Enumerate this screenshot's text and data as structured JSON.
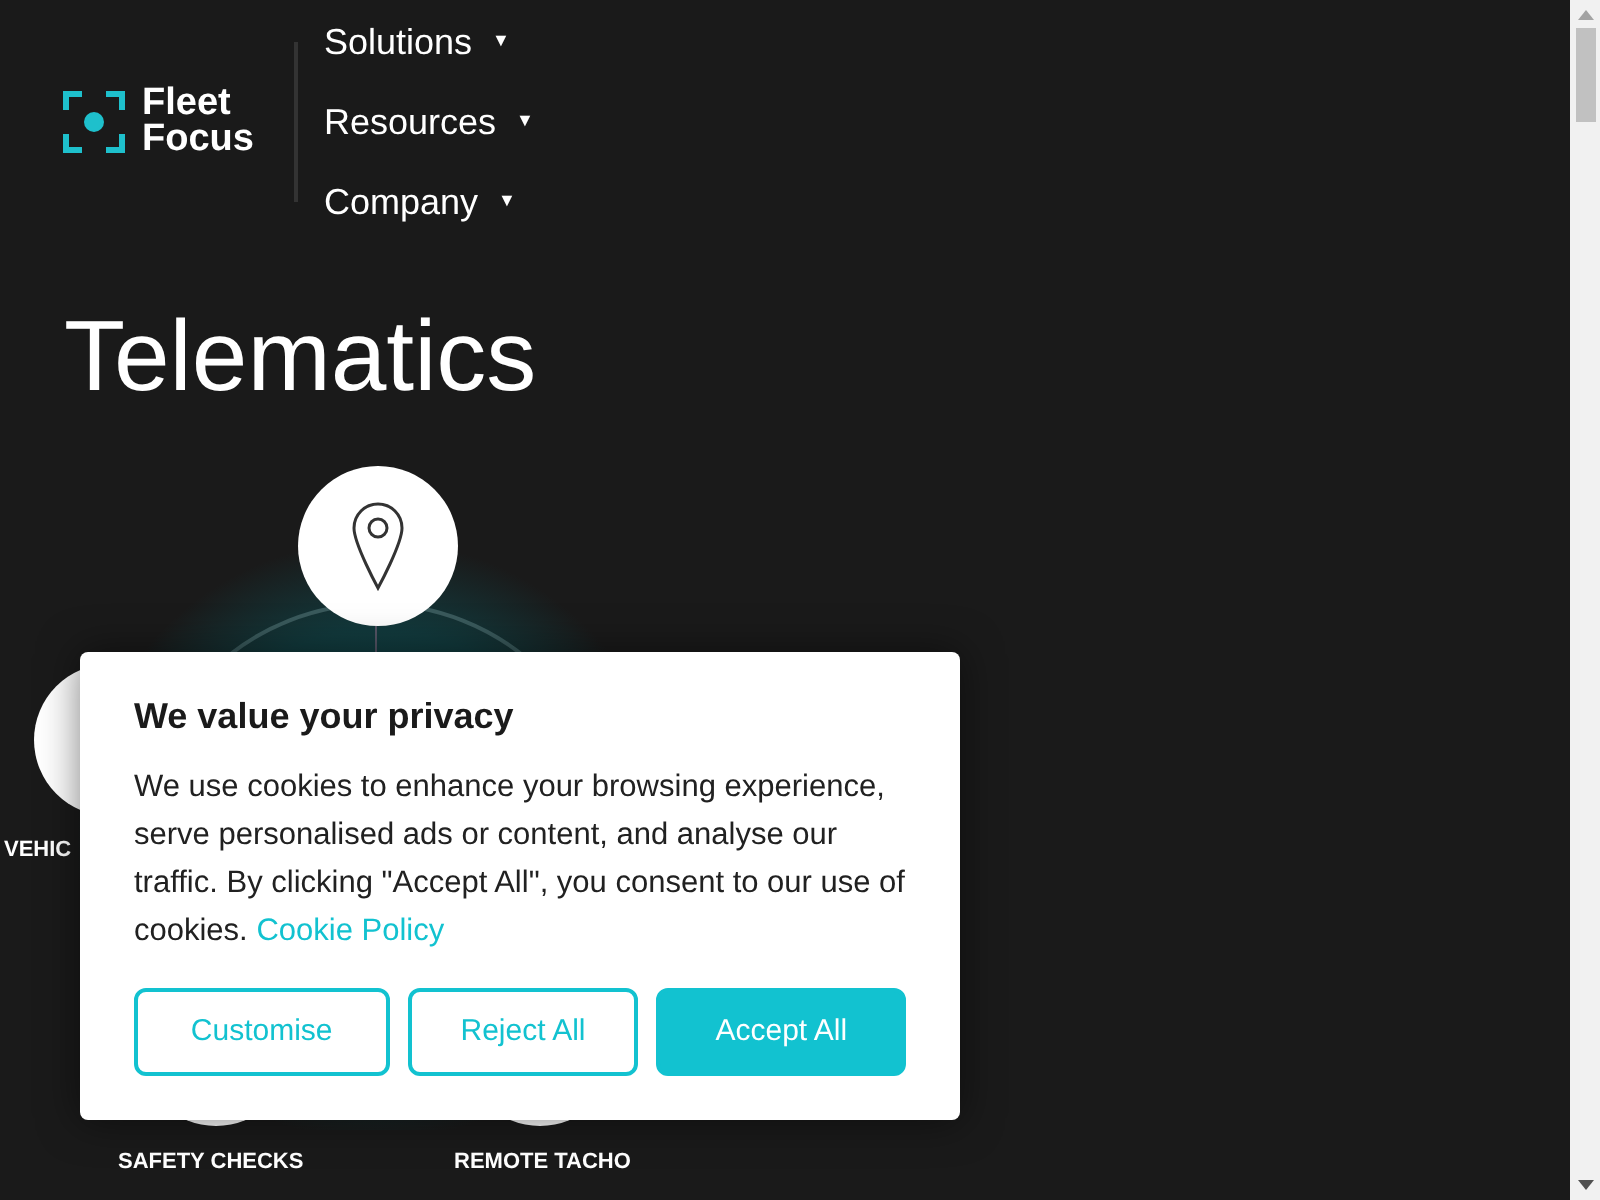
{
  "logo": {
    "line_1": "Fleet",
    "line_2": "Focus"
  },
  "nav": [
    {
      "label": "Solutions",
      "caret": "▼"
    },
    {
      "label": "Resources",
      "caret": "▼"
    },
    {
      "label": "Company",
      "caret": "▼"
    }
  ],
  "hero": {
    "title_line_2": "Telematics"
  },
  "diagram": {
    "labels": [
      {
        "text": "VEHIC",
        "kind": "left"
      },
      {
        "text": "SAFETY CHECKS",
        "kind": "bottom_left"
      },
      {
        "text": "REMOTE TACHO",
        "kind": "bottom_right"
      }
    ]
  },
  "cookie_banner": {
    "title": "We value your privacy",
    "body": "We use cookies to enhance your browsing experience, serve personalised ads or content, and analyse our traffic. By clicking \"Accept All\", you consent to our use of cookies.",
    "link": "Cookie Policy",
    "buttons": [
      {
        "label": "Customise",
        "kind": "outline"
      },
      {
        "label": "Reject All",
        "kind": "outline"
      },
      {
        "label": "Accept All",
        "kind": "filled"
      }
    ]
  }
}
